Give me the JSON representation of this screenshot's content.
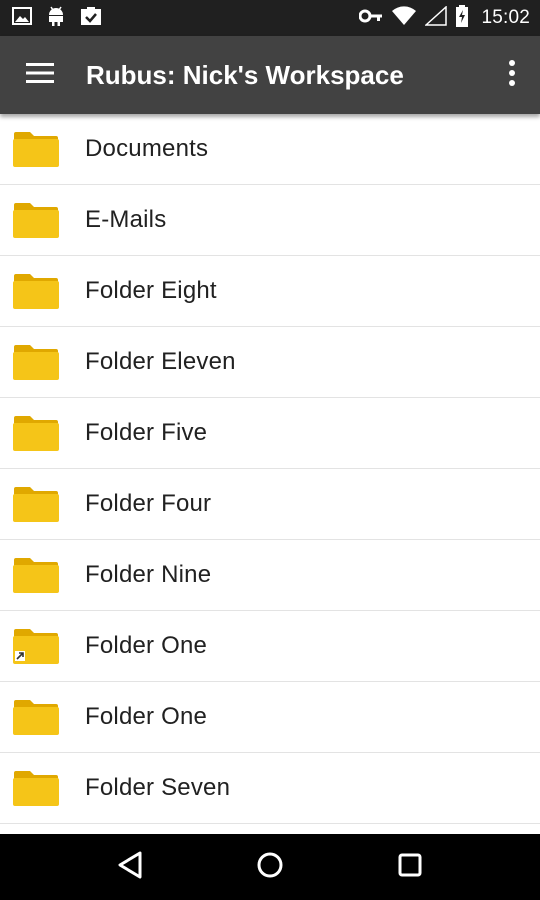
{
  "status_bar": {
    "time": "15:02",
    "left_icons": [
      "image-icon",
      "android-icon",
      "clipboard-check-icon"
    ],
    "right_icons": [
      "key-icon",
      "wifi-icon",
      "signal-icon",
      "battery-charging-icon"
    ]
  },
  "app_bar": {
    "title": "Rubus: Nick's Workspace",
    "background": "#424242"
  },
  "folders": [
    {
      "name": "Documents",
      "shortcut": false
    },
    {
      "name": "E-Mails",
      "shortcut": false
    },
    {
      "name": "Folder Eight",
      "shortcut": false
    },
    {
      "name": "Folder Eleven",
      "shortcut": false
    },
    {
      "name": "Folder Five",
      "shortcut": false
    },
    {
      "name": "Folder Four",
      "shortcut": false
    },
    {
      "name": "Folder Nine",
      "shortcut": false
    },
    {
      "name": "Folder One",
      "shortcut": true
    },
    {
      "name": "Folder One",
      "shortcut": false
    },
    {
      "name": "Folder Seven",
      "shortcut": false
    }
  ],
  "colors": {
    "folder": "#F5C518",
    "folder_dark": "#E0A800",
    "status_bar": "#202020",
    "nav_bar": "#000000"
  },
  "nav_bar": {
    "buttons": [
      "back-icon",
      "home-icon",
      "recents-icon"
    ]
  }
}
